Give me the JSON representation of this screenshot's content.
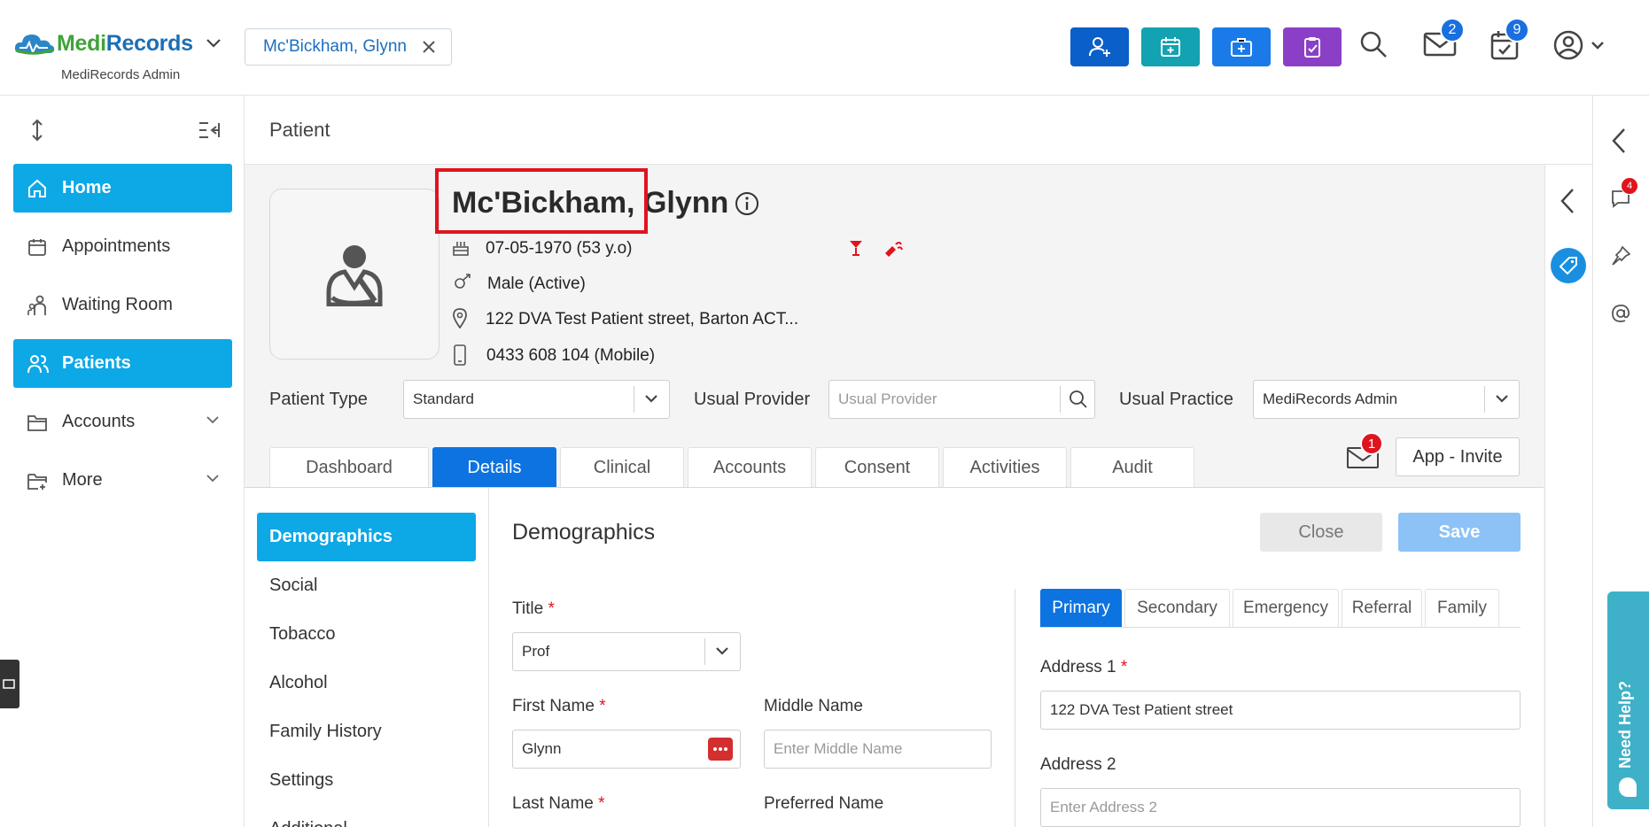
{
  "header": {
    "logo_text_a": "Medi",
    "logo_text_b": "Records",
    "logo_sub": "MediRecords Admin",
    "patient_chip": "Mc'Bickham, Glynn",
    "mail_badge": "2",
    "calendar_badge": "9",
    "colors": {
      "add_patient": "#0a5fc9",
      "add_appointment": "#13a2b1",
      "add_medical": "#1a7be8",
      "task": "#8b3fc6"
    }
  },
  "sidebar": {
    "items": [
      {
        "label": "Home",
        "icon": "home-icon"
      },
      {
        "label": "Appointments",
        "icon": "calendar-icon"
      },
      {
        "label": "Waiting Room",
        "icon": "waiting-room-icon"
      },
      {
        "label": "Patients",
        "icon": "patients-icon"
      },
      {
        "label": "Accounts",
        "icon": "folder-icon"
      },
      {
        "label": "More",
        "icon": "folder-plus-icon"
      }
    ]
  },
  "page": {
    "title": "Patient"
  },
  "patient": {
    "surname": "Mc'Bickham,",
    "firstname": "Glynn",
    "dob": "07-05-1970 (53 y.o)",
    "gender": "Male (Active)",
    "address": "122 DVA Test Patient street, Barton ACT...",
    "phone": "0433 608 104 (Mobile)"
  },
  "fields": {
    "patient_type_label": "Patient Type",
    "patient_type_value": "Standard",
    "usual_provider_label": "Usual Provider",
    "usual_provider_placeholder": "Usual Provider",
    "usual_practice_label": "Usual Practice",
    "usual_practice_value": "MediRecords Admin"
  },
  "tabs": [
    "Dashboard",
    "Details",
    "Clinical",
    "Accounts",
    "Consent",
    "Activities",
    "Audit"
  ],
  "message_badge": "1",
  "invite_label": "App - Invite",
  "subnav": [
    "Demographics",
    "Social",
    "Tobacco",
    "Alcohol",
    "Family History",
    "Settings",
    "Additional"
  ],
  "form": {
    "section_title": "Demographics",
    "close_label": "Close",
    "save_label": "Save",
    "title_label": "Title",
    "title_value": "Prof",
    "first_name_label": "First Name",
    "first_name_value": "Glynn",
    "middle_name_label": "Middle Name",
    "middle_name_placeholder": "Enter Middle Name",
    "last_name_label": "Last Name",
    "preferred_name_label": "Preferred Name",
    "required_mark": "*"
  },
  "address": {
    "tabs": [
      "Primary",
      "Secondary",
      "Emergency",
      "Referral",
      "Family"
    ],
    "address1_label": "Address 1",
    "address1_value": "122 DVA Test Patient street",
    "address2_label": "Address 2",
    "address2_placeholder": "Enter Address 2"
  },
  "right_panel": {
    "chat_badge": "4"
  },
  "need_help": "Need Help?"
}
